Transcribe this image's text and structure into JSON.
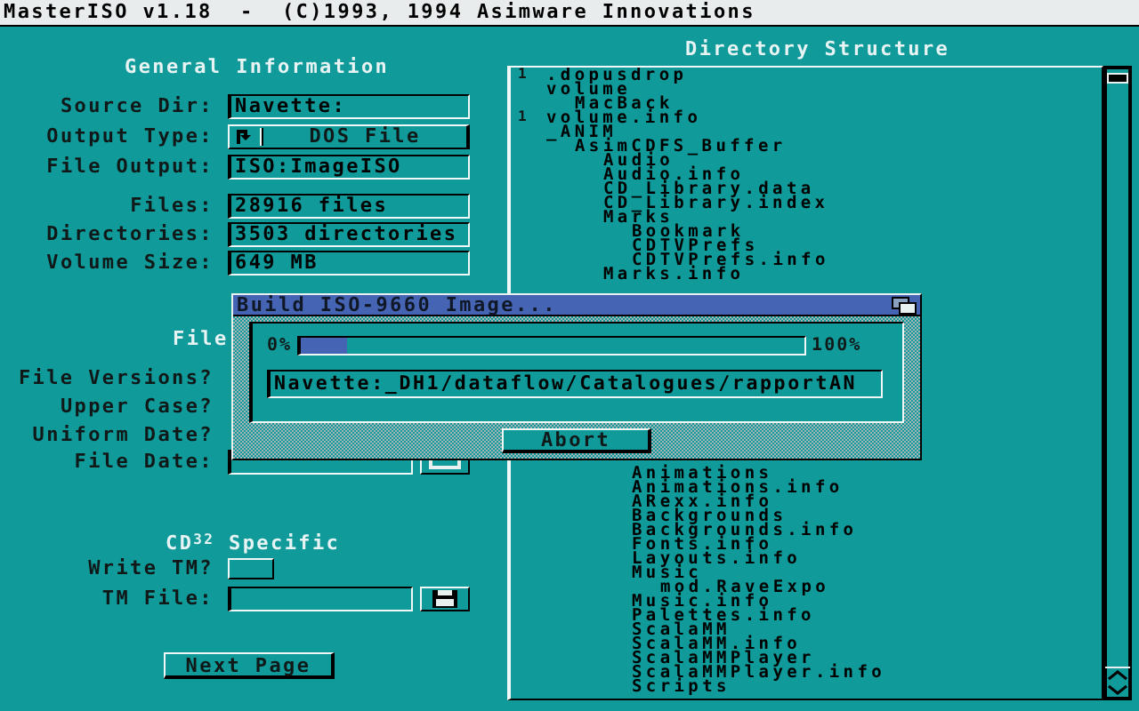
{
  "title_bar": {
    "title": "MasterISO v1.18  -  (C)1993, 1994 Asimware Innovations"
  },
  "general": {
    "heading": "General Information",
    "fields": [
      {
        "label": "Source Dir:",
        "value": "Navette:",
        "kind": "text"
      },
      {
        "label": "Output Type:",
        "value": "DOS File",
        "kind": "cycle"
      },
      {
        "label": "File Output:",
        "value": "ISO:ImageISO",
        "kind": "text"
      }
    ],
    "statistics": [
      {
        "label": "Files:",
        "value": "28916 files"
      },
      {
        "label": "Directories:",
        "value": "3503 directories"
      },
      {
        "label": "Volume Size:",
        "value": "649 MB"
      }
    ]
  },
  "file_section": {
    "heading": "File",
    "labels": [
      "File Versions?",
      "Upper Case?",
      "Uniform Date?"
    ],
    "date_label": "File Date:"
  },
  "cd32": {
    "heading": "CD$^{32}$ Specific",
    "write_tm": {
      "label": "Write TM?",
      "checked": false
    },
    "tm_file": {
      "label": "TM File:"
    }
  },
  "next_button": "Next Page",
  "directory": {
    "heading": "Directory Structure",
    "top_items": [
      {
        "name": ".dopusdrop",
        "mark": "1"
      },
      {
        "name": "volume",
        "children": [
          {
            "name": "MacBack"
          }
        ]
      },
      {
        "name": "volume.info",
        "mark": "1"
      },
      {
        "name": "_ANIM",
        "children": [
          {
            "name": "AsimCDFS_Buffer",
            "children": [
              {
                "name": "Audio"
              },
              {
                "name": "Audio.info"
              },
              {
                "name": "CD_Library.data"
              },
              {
                "name": "CD_Library.index"
              },
              {
                "name": "Marks",
                "children": [
                  {
                    "name": "Bookmark"
                  },
                  {
                    "name": "CDTVPrefs"
                  },
                  {
                    "name": "CDTVPrefs.info"
                  }
                ]
              },
              {
                "name": "Marks.info"
              }
            ]
          }
        ]
      }
    ],
    "bottom_items": [
      {
        "name": "Animations"
      },
      {
        "name": "Animations.info"
      },
      {
        "name": "ARexx.info"
      },
      {
        "name": "Backgrounds"
      },
      {
        "name": "Backgrounds.info"
      },
      {
        "name": "Fonts.info"
      },
      {
        "name": "Layouts.info"
      },
      {
        "name": "Music",
        "children": [
          {
            "name": "mod.RaveExpo"
          }
        ]
      },
      {
        "name": "Music.info"
      },
      {
        "name": "Palettes.info"
      },
      {
        "name": "ScalaMM"
      },
      {
        "name": "ScalaMM.info"
      },
      {
        "name": "ScalaMMPlayer"
      },
      {
        "name": "ScalaMMPlayer.info"
      },
      {
        "name": "Scripts"
      }
    ]
  },
  "dialog": {
    "title": "Build ISO-9660 Image...",
    "start_label": "0%",
    "end_label": "100%",
    "level": 0.09,
    "path": "Navette:_DH1/dataflow/Catalogues/rapportAN",
    "button": "Abort"
  }
}
